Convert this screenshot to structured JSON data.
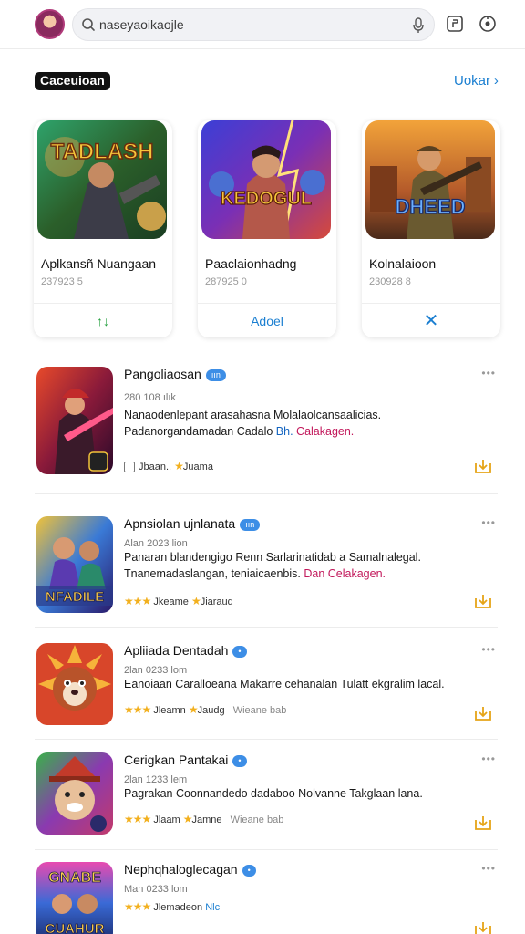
{
  "header": {
    "search_text": "naseyaoikaojle",
    "icons": [
      "avatar",
      "search-icon",
      "mic-icon",
      "tablet-icon",
      "settings-icon"
    ]
  },
  "section": {
    "title": "Caceuioan",
    "more": "Uokar",
    "more_arrow": "›"
  },
  "featured": [
    {
      "art_text": "TADLASH",
      "name": "Aplkansñ Nuangaan",
      "meta": "237923 5",
      "button": "↑↓",
      "button_color": "#1f9d3a"
    },
    {
      "art_text": "KEDOGUL",
      "name": "Paaclaionhadng",
      "meta": "287925 0",
      "button": "Adoel",
      "button_color": "#1b7fd1"
    },
    {
      "art_text": "DHEED",
      "name": "Kolnalaioon",
      "meta": "230928 8",
      "button": "✕",
      "button_color": "#1b7fd1"
    }
  ],
  "list": [
    {
      "title": "Pangoliaosan",
      "badge": "ıın",
      "meta": "280 108 ılık",
      "desc": "Nanaodenlepant arasahasna Molalaolcansaalicias.",
      "desc2_plain": "Padanorgandamadan Cadalo ",
      "desc2_blue": "Bh.",
      "desc2_hl": " Calakagen.",
      "rating_a": "Jbaan..",
      "rating_b": "Juama",
      "rating_mode": "box"
    },
    {
      "title": "Apnsiolan ujnlanata",
      "badge": "ıın",
      "meta": "Alan 2023 lion",
      "desc": "Panaran blandengigo Renn Sarlarinatidab a Samalnalegal.",
      "desc2_plain": "Tnanemadaslangan, teniaicaenbis. ",
      "desc2_blue": "",
      "desc2_hl": "Dan Celakagen.",
      "rating_a": "Jkeame",
      "rating_b": "Jiaraud",
      "rating_mode": "stars"
    },
    {
      "title": "Apliiada Dentadah",
      "badge": "•",
      "meta": "2lan 0233 lom",
      "desc": "Eanoiaan Caralloeana Makarre cehanalan Tulatt ekgralim lacal.",
      "desc2_plain": "",
      "desc2_blue": "",
      "desc2_hl": "",
      "rating_a": "Jleamn",
      "rating_b": "Jaudg",
      "rating_sub": "Wieane bab",
      "rating_mode": "stars"
    },
    {
      "title": "Cerigkan Pantakai",
      "badge": "•",
      "meta": "2lan 1233 lem",
      "desc": "Pagrakan Coonnandedo dadaboo Nolvanne Takglaan lana.",
      "desc2_plain": "",
      "desc2_blue": "",
      "desc2_hl": "",
      "rating_a": "Jlaam",
      "rating_b": "Jamne",
      "rating_sub": "Wieane bab",
      "rating_mode": "stars"
    },
    {
      "title": "Nephqhaloglecagan",
      "badge": "•",
      "meta": "Man 0233 lom",
      "desc": "",
      "desc2_plain": "",
      "desc2_blue": "",
      "desc2_hl": "",
      "rating_a": "Jlemadeon",
      "rating_b": "Nlc",
      "rating_mode": "stars"
    }
  ],
  "colors": {
    "accent": "#1b7fd1",
    "badge": "#3d8ee6",
    "star": "#f2b01e",
    "download": "#e6a417",
    "highlight": "#c2185b"
  }
}
